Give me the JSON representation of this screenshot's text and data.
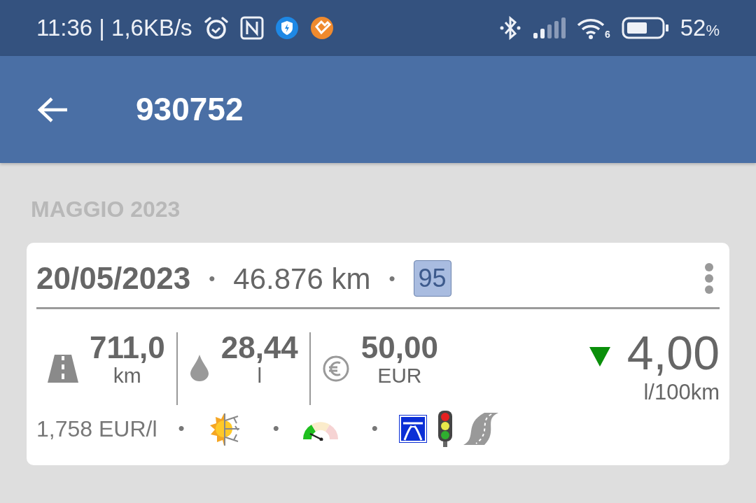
{
  "status_bar": {
    "time": "11:36 | 1,6KB/s",
    "wifi_label": "6",
    "battery": "52",
    "battery_unit": "%"
  },
  "app_bar": {
    "title": "930752"
  },
  "section": {
    "title": "MAGGIO 2023"
  },
  "entry": {
    "header": [
      {
        "kind": "date",
        "text": "20/05/2023"
      },
      {
        "kind": "dot",
        "text": "•"
      },
      {
        "kind": "odometer",
        "text": "46.876 km"
      },
      {
        "kind": "dot",
        "text": "•"
      },
      {
        "kind": "fuel-badge",
        "text": "95"
      }
    ],
    "stats": [
      {
        "kind": "distance",
        "value": "711,0",
        "unit": "km"
      },
      {
        "kind": "fuel",
        "value": "28,44",
        "unit": "l"
      },
      {
        "kind": "cost",
        "value": "50,00",
        "unit": "EUR"
      }
    ],
    "consumption": {
      "value": "4,00",
      "unit": "l/100km",
      "trend_down": true
    },
    "footer": [
      {
        "kind": "price",
        "text": "1,758 EUR/l"
      },
      {
        "kind": "dot",
        "text": "•"
      },
      {
        "kind": "season"
      },
      {
        "kind": "dot",
        "text": "•"
      },
      {
        "kind": "driving-style"
      },
      {
        "kind": "dot",
        "text": "•"
      },
      {
        "kind": "motorway"
      },
      {
        "kind": "city"
      },
      {
        "kind": "country-road"
      }
    ]
  }
}
